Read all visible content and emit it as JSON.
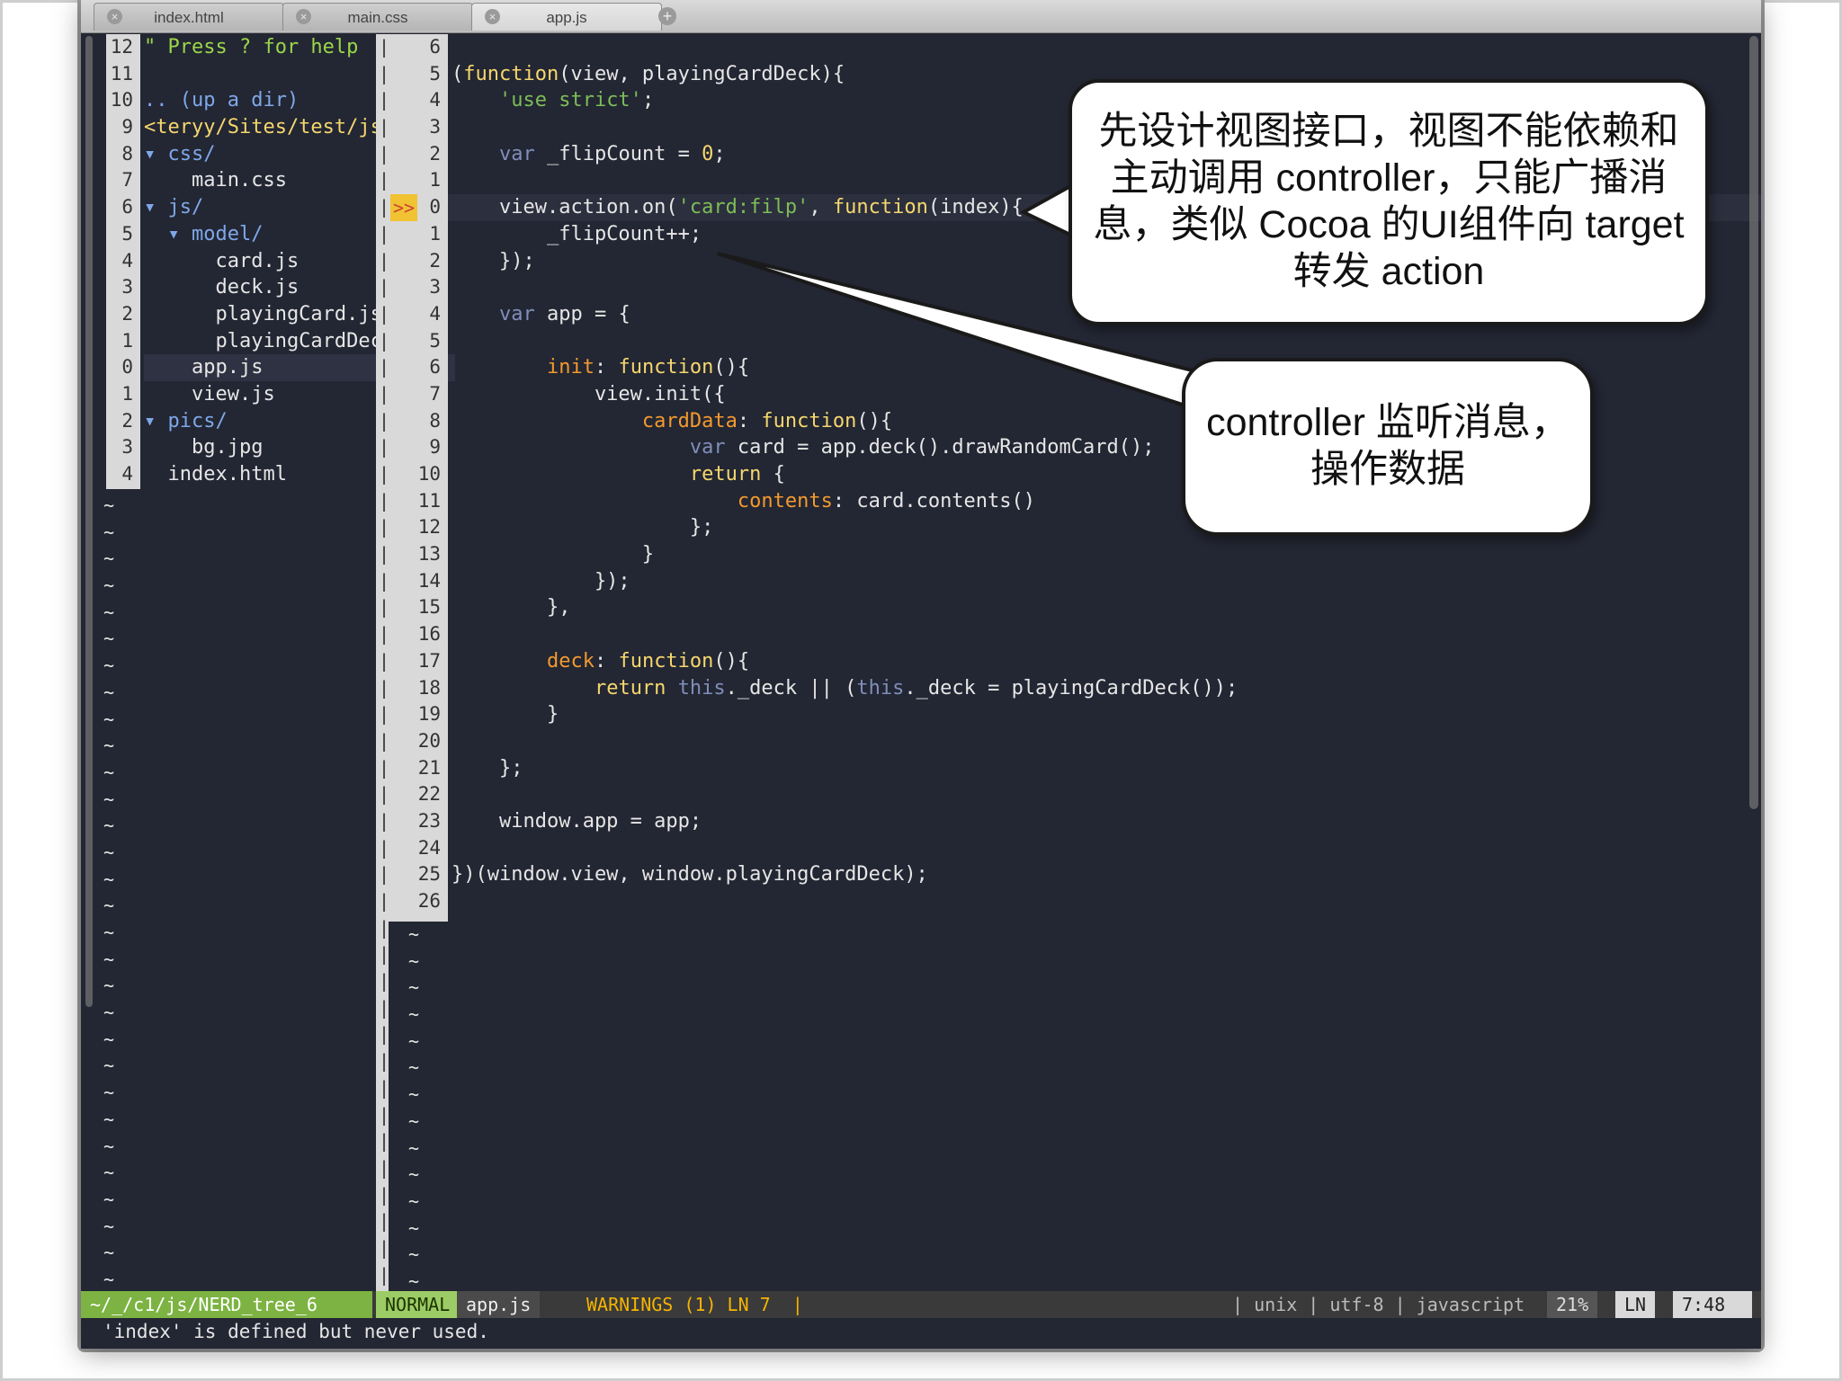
{
  "tabs": [
    {
      "label": "index.html",
      "active": false
    },
    {
      "label": "main.css",
      "active": false
    },
    {
      "label": "app.js",
      "active": true
    }
  ],
  "tree": {
    "line_numbers": [
      "12",
      "11",
      "10",
      "9",
      "8",
      "7",
      "6",
      "5",
      "4",
      "3",
      "2",
      "1",
      "0",
      "1",
      "2",
      "3",
      "4"
    ],
    "lines": [
      {
        "text": "\" Press ? for help",
        "cls": "grn"
      },
      {
        "text": "",
        "cls": "wh"
      },
      {
        "text": ".. (up a dir)",
        "cls": "dir"
      },
      {
        "text": "<teryy/Sites/test/js",
        "cls": "fn"
      },
      {
        "text": "▾ css/",
        "cls": "dir"
      },
      {
        "text": "    main.css",
        "cls": "wh"
      },
      {
        "text": "▾ js/",
        "cls": "dir"
      },
      {
        "text": "  ▾ model/",
        "cls": "dir"
      },
      {
        "text": "      card.js",
        "cls": "wh"
      },
      {
        "text": "      deck.js",
        "cls": "wh"
      },
      {
        "text": "      playingCard.js",
        "cls": "wh"
      },
      {
        "text": "      playingCardDec",
        "cls": "wh"
      },
      {
        "text": "    app.js",
        "cls": "wh"
      },
      {
        "text": "    view.js",
        "cls": "wh"
      },
      {
        "text": "▾ pics/",
        "cls": "dir"
      },
      {
        "text": "    bg.jpg",
        "cls": "wh"
      },
      {
        "text": "  index.html",
        "cls": "wh"
      }
    ]
  },
  "editor": {
    "line_numbers": [
      "6",
      "5",
      "4",
      "3",
      "2",
      "1",
      "0",
      "1",
      "2",
      "3",
      "4",
      "5",
      "6",
      "7",
      "8",
      "9",
      "10",
      "11",
      "12",
      "13",
      "14",
      "15",
      "16",
      "17",
      "18",
      "19",
      "20",
      "21",
      "22",
      "23",
      "24",
      "25",
      "26"
    ],
    "sign": ">>",
    "code": [
      "",
      "(function(view, playingCardDeck){",
      "    'use strict';",
      "",
      "    var _flipCount = 0;",
      "",
      "    view.action.on('card:filp', function(index){",
      "        _flipCount++;",
      "    });",
      "",
      "    var app = {",
      "",
      "        init: function(){",
      "            view.init({",
      "                cardData: function(){",
      "                    var card = app.deck().drawRandomCard();",
      "                    return {",
      "                        contents: card.contents()",
      "                    };",
      "                }",
      "            });",
      "        },",
      "",
      "        deck: function(){",
      "            return this._deck || (this._deck = playingCardDeck());",
      "        }",
      "",
      "    };",
      "",
      "    window.app = app;",
      "",
      "})(window.view, window.playingCardDeck);",
      ""
    ]
  },
  "statusbar": {
    "path": "~/_/c1/js/NERD_tree_6",
    "mode": "NORMAL",
    "file": "app.js",
    "warnings": "WARNINGS (1) LN 7  |",
    "fileinfo": "| unix | utf-8 | javascript",
    "percent": "21%",
    "ln_label": "LN",
    "position": "7:48"
  },
  "command_line": "'index' is defined but never used.",
  "callouts": {
    "top": [
      "先设计视图接口，视图不能依赖和",
      "主动调用 controller，只能广播消",
      "息，类似 Cocoa 的UI组件向 target",
      "转发 action"
    ],
    "bottom": [
      "controller 监听消息，",
      "操作数据"
    ]
  },
  "colors": {
    "editor_bg": "#232633",
    "statusbar_path_bg": "#7cb342",
    "mode_bg": "#9ccc65",
    "warning": "#f5b400"
  }
}
